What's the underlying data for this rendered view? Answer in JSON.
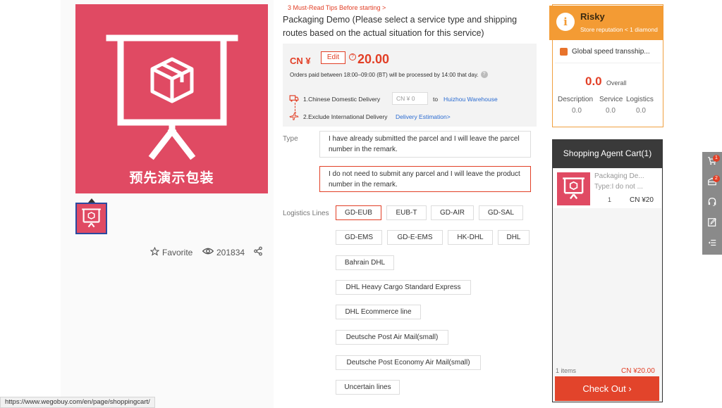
{
  "product": {
    "image_caption": "预先演示包装",
    "favorite_label": "Favorite",
    "views_count": "201834",
    "tips_link": "3 Must-Read Tips Before starting >",
    "title": "Packaging Demo (Please select a service type and shipping routes based on the actual situation for this service)",
    "currency_label": "CN ¥",
    "edit_label": "Edit",
    "price": "20.00",
    "orders_note": "Orders paid between 18:00–09:00 (BT) will be processed by 14:00 that day.",
    "shipping": {
      "domestic_label": "1.Chinese Domestic Delivery",
      "domestic_input_placeholder": "CN ¥ 0",
      "to_label": "to",
      "warehouse": "Huizhou Warehouse",
      "international_label": "2.Exclude International Delivery",
      "estimation_link": "Delivery Estimation>"
    },
    "type_label": "Type",
    "type_options": [
      "I have already submitted the parcel and I will leave the parcel number in the remark.",
      "I do not need to submit any parcel and I will leave the product number in the remark."
    ],
    "type_selected_index": 1,
    "logistics_label": "Logistics Lines",
    "logistics_lines": [
      "GD-EUB",
      "EUB-T",
      "GD-AIR",
      "GD-SAL",
      "GD-EMS",
      "GD-E-EMS",
      "HK-DHL",
      "DHL",
      "Bahrain DHL",
      "DHL Heavy Cargo Standard Express",
      "DHL Ecommerce line",
      "Deutsche Post Air Mail(small)",
      "Deutsche Post Economy Air Mail(small)",
      "Uncertain lines"
    ],
    "logistics_selected_index": 0
  },
  "store": {
    "risk_label": "Risky",
    "reputation": "Store reputation < 1 diamond",
    "name": "Global speed transship...",
    "overall_score": "0.0",
    "overall_label": "Overall",
    "ratings": [
      {
        "label": "Description",
        "value": "0.0"
      },
      {
        "label": "Service",
        "value": "0.0"
      },
      {
        "label": "Logistics",
        "value": "0.0"
      }
    ],
    "accent_color": "#f39b34"
  },
  "cart": {
    "title": "Shopping Agent Cart(1)",
    "item_name": "Packaging De...",
    "item_type": "Type:I do not ...",
    "item_qty": "1",
    "item_price": "CN ¥20",
    "items_count": "1 items",
    "total": "CN ¥20.00",
    "checkout_label": "Check Out ›"
  },
  "side_toolbar": {
    "cart_badge": "1",
    "package_badge": "2"
  },
  "status_bar": {
    "url": "https://www.wegobuy.com/en/page/shoppingcart/"
  },
  "colors": {
    "brand_red": "#e23f26",
    "product_pink": "#e04a63",
    "link_blue": "#2a6bd1"
  }
}
